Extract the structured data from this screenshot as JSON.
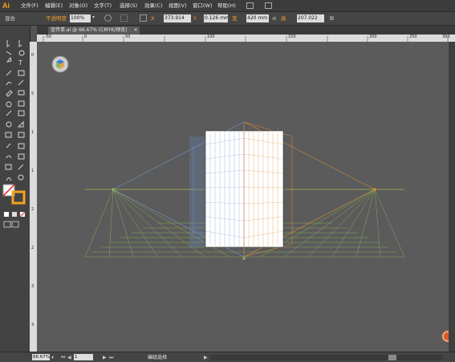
{
  "app": {
    "logo": "Ai"
  },
  "menu": [
    "文件(F)",
    "编辑(E)",
    "对象(O)",
    "文字(T)",
    "选择(S)",
    "效果(C)",
    "视图(V)",
    "窗口(W)",
    "帮助(H)"
  ],
  "control": {
    "mode_label": "混合",
    "opacity_label": "不透明度",
    "opacity_value": "100%",
    "x_value": "373.914",
    "y_value": "0.126 mm",
    "width_label": "宽",
    "width_value": "420 mm",
    "height_label": "高",
    "height_value": "207.022"
  },
  "document": {
    "tab_title": "宣传单.ai @ 66.67% (CMYK/预览)",
    "close": "×"
  },
  "rulers": {
    "h_ticks": [
      "-50",
      "0",
      "50",
      "100",
      "150",
      "200",
      "250",
      "300"
    ],
    "v_ticks": [
      "0",
      "5",
      "1",
      "1",
      "2",
      "2",
      "3",
      "3"
    ]
  },
  "status": {
    "zoom": "66.67%",
    "page": "1",
    "tool_state": "编组选择"
  },
  "colors": {
    "canvas": "#5b5b5b",
    "artboard": "#ffffff",
    "grid_blue": "#6d8fc9",
    "grid_orange": "#d98736",
    "grid_green": "#8fb55a",
    "accent": "#f7a21b"
  }
}
